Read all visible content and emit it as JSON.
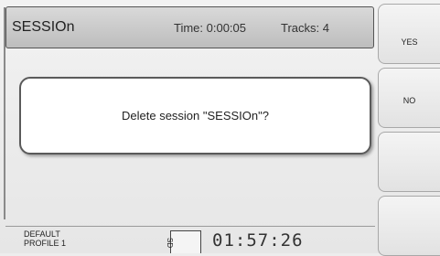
{
  "header": {
    "session_name": "SESSIOn",
    "time": "Time: 0:00:05",
    "tracks": "Tracks: 4"
  },
  "softkeys": [
    "YES",
    "NO",
    "",
    ""
  ],
  "dialog": {
    "message": "Delete session \"SESSIOn\"?"
  },
  "footer": {
    "profile_line1": "DEFAULT",
    "profile_line2": "PROFILE 1",
    "indicator": "SD",
    "counter": "01:57:26"
  }
}
